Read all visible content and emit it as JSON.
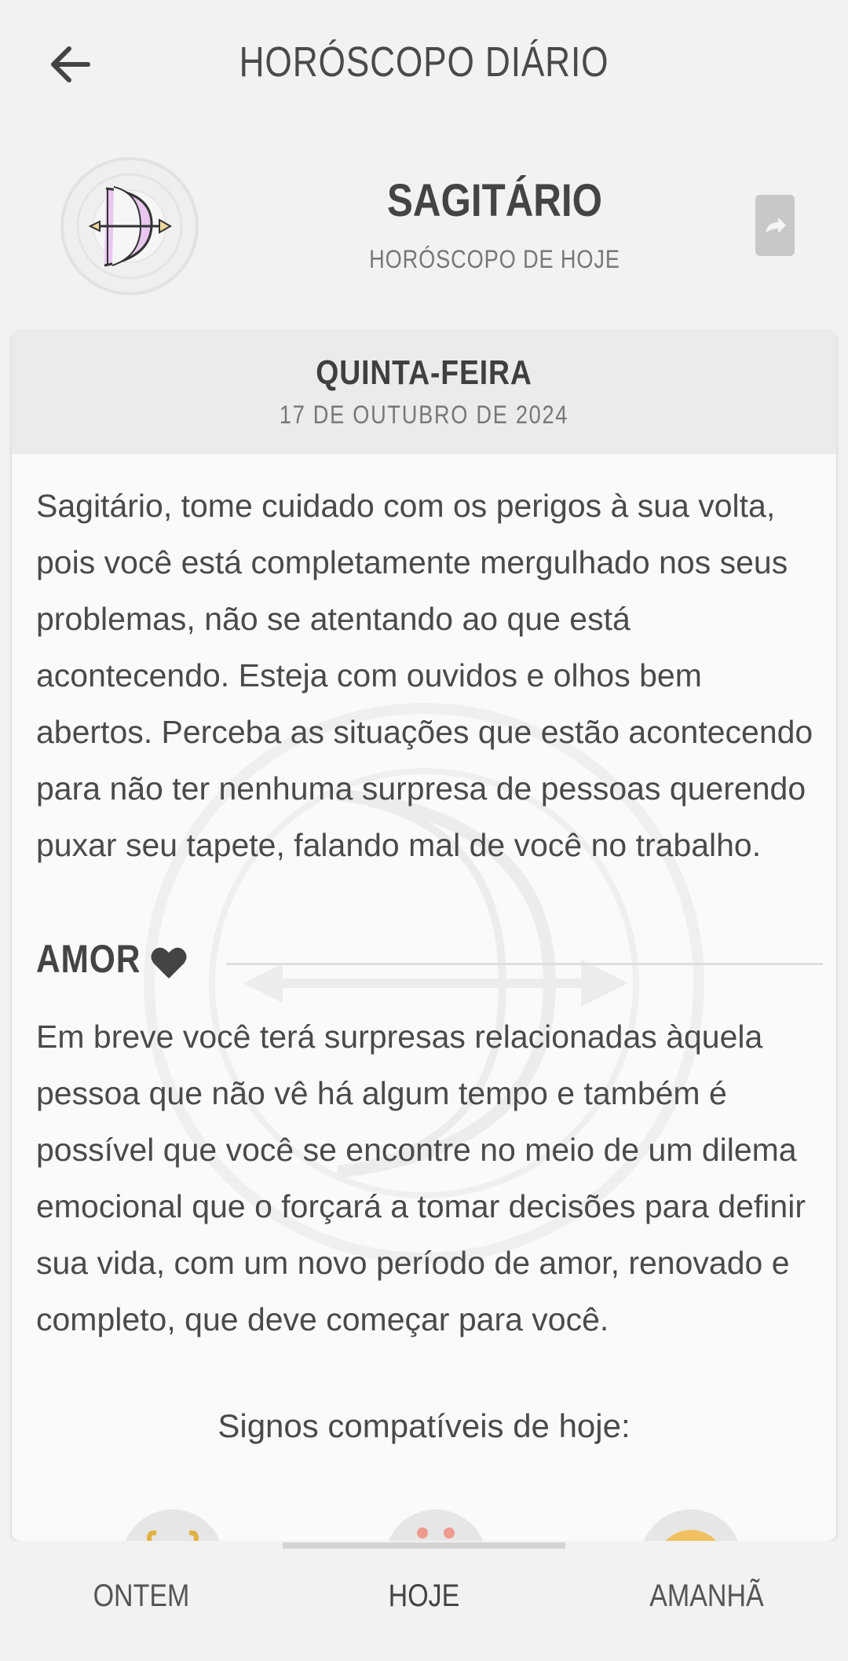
{
  "header": {
    "title": "HORÓSCOPO DIÁRIO",
    "back_icon": "arrow-left-icon"
  },
  "sign": {
    "name": "SAGITÁRIO",
    "subtitle": "HORÓSCOPO DE HOJE",
    "icon": "sagittarius-bow-icon",
    "share_icon": "share-icon"
  },
  "day": {
    "weekday": "QUINTA-FEIRA",
    "date": "17 DE OUTUBRO DE 2024"
  },
  "horoscope_text": "Sagitário, tome cuidado com os perigos à sua volta, pois você está completamente mergulhado nos seus problemas, não se atentando ao que está acontecendo. Esteja com ouvidos e olhos bem abertos. Perceba as situações que estão acontecendo para não ter nenhuma surpresa de pessoas querendo puxar seu tapete, falando mal de você no trabalho.",
  "love": {
    "label": "AMOR",
    "icon": "heart-icon",
    "text": "Em breve você terá surpresas relacionadas àquela pessoa que não vê há algum tempo e também é possível que você se encontre no meio de um dilema emocional que o forçará a tomar decisões para definir sua vida, com um novo período de amor, renovado e completo, que deve começar para você."
  },
  "compatible": {
    "title": "Signos compatíveis de hoje:",
    "signs": [
      "aries-icon",
      "cancer-icon",
      "leo-icon"
    ]
  },
  "nav": {
    "items": [
      {
        "label": "ONTEM"
      },
      {
        "label": "HOJE"
      },
      {
        "label": "AMANHÃ"
      }
    ],
    "active": "HOJE"
  },
  "colors": {
    "background": "#f2f2f2",
    "card": "#fafafa",
    "card_header": "#ebebeb",
    "text": "#444444",
    "accent_bow": "#c9a0d8"
  }
}
